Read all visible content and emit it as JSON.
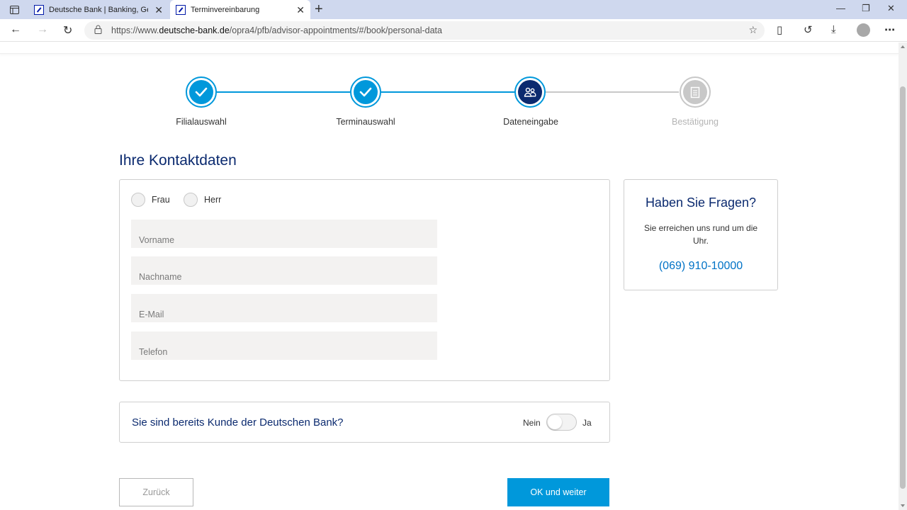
{
  "browser": {
    "tabs": [
      {
        "title": "Deutsche Bank | Banking, Geldanlage"
      },
      {
        "title": "Terminvereinbarung"
      }
    ],
    "url_prefix": "https://www.",
    "url_domain": "deutsche-bank.de",
    "url_path": "/opra4/pfb/advisor-appointments/#/book/personal-data"
  },
  "stepper": {
    "steps": [
      {
        "label": "Filialauswahl",
        "state": "done"
      },
      {
        "label": "Terminauswahl",
        "state": "done"
      },
      {
        "label": "Dateneingabe",
        "state": "current"
      },
      {
        "label": "Bestätigung",
        "state": "todo"
      }
    ]
  },
  "contact": {
    "heading": "Ihre Kontaktdaten",
    "salutation_options": [
      "Frau",
      "Herr"
    ],
    "fields": [
      {
        "placeholder": "Vorname",
        "value": ""
      },
      {
        "placeholder": "Nachname",
        "value": ""
      },
      {
        "placeholder": "E-Mail",
        "value": ""
      },
      {
        "placeholder": "Telefon",
        "value": ""
      }
    ]
  },
  "help": {
    "title": "Haben Sie Fragen?",
    "text": "Sie erreichen uns rund um die Uhr.",
    "phone": "(069) 910-10000"
  },
  "customer": {
    "question": "Sie sind bereits Kunde der Deutschen Bank?",
    "no_label": "Nein",
    "yes_label": "Ja",
    "is_customer": false
  },
  "actions": {
    "back_label": "Zurück",
    "next_label": "OK und weiter"
  },
  "colors": {
    "accent": "#0098db",
    "brand_dark": "#0b2a6f",
    "link": "#0072c6"
  }
}
